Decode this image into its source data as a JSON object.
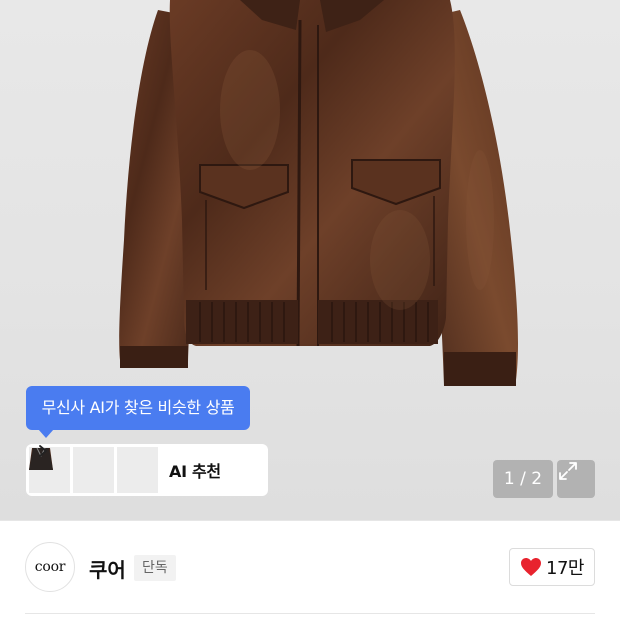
{
  "product_image": {
    "description_icon": "leather-jacket-image",
    "page_indicator": "1 / 2"
  },
  "ai_tooltip": {
    "text": "무신사 AI가 찾은 비슷한 상품"
  },
  "ai_recommend": {
    "label": "AI 추천",
    "thumbnails": [
      "jacket-thumb-1",
      "jacket-thumb-2",
      "jacket-thumb-3"
    ]
  },
  "brand": {
    "logo_text": "coor",
    "name": "쿠어",
    "badge": "단독"
  },
  "like": {
    "count": "17만",
    "icon": "heart-icon",
    "color": "#e8232e"
  },
  "colors": {
    "accent_blue": "#4a7cf0",
    "jacket_brown": "#5a3322"
  }
}
